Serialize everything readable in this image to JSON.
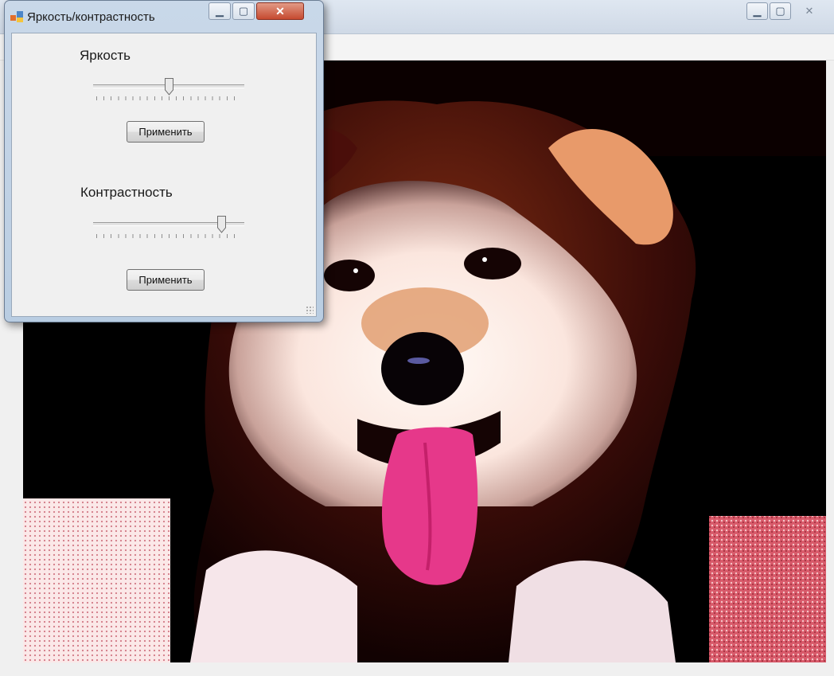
{
  "main_window": {
    "caption_buttons": {
      "minimize_icon": "minimize-icon",
      "maximize_icon": "maximize-icon",
      "close_icon": "close-icon"
    },
    "image": {
      "subject_icon": "dog-photo",
      "colors": {
        "background": "#000000",
        "fur_light": "#fff4ee",
        "fur_dark": "#2a0808",
        "tongue": "#e6388a",
        "cushion": "#d85a6a"
      }
    }
  },
  "dialog": {
    "title": "Яркость/контрастность",
    "app_icon": "form-app-icon",
    "brightness": {
      "label": "Яркость",
      "value": 0.5,
      "apply_label": "Применить"
    },
    "contrast": {
      "label": "Контрастность",
      "value": 0.87,
      "apply_label": "Применить"
    },
    "colors": {
      "frame": "#b9cde2",
      "client": "#f0f0f0",
      "close": "#c64a30"
    }
  }
}
